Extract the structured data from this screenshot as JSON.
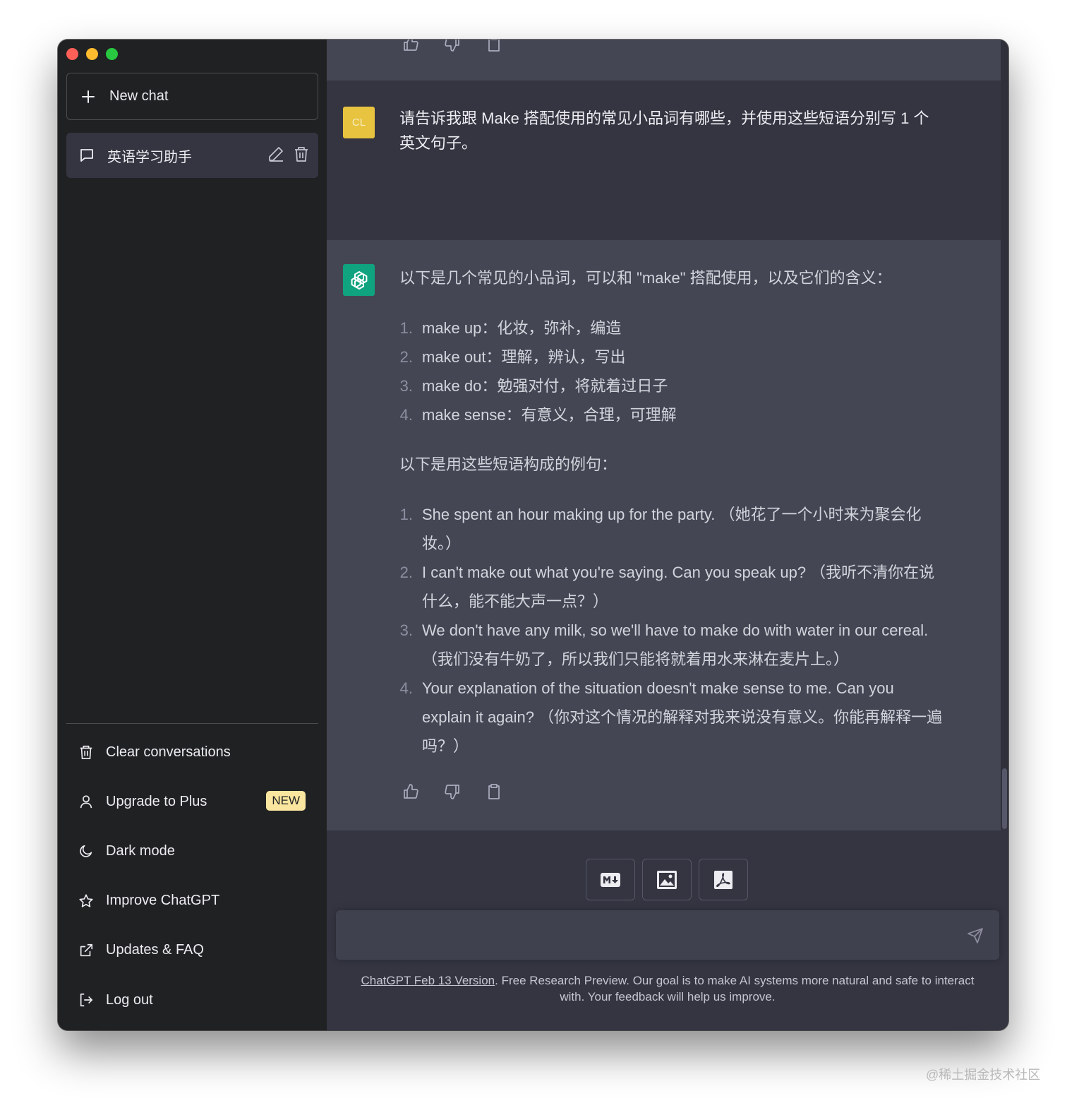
{
  "sidebar": {
    "new_chat_label": "New chat",
    "conversations": [
      {
        "title": "英语学习助手"
      }
    ],
    "menu": {
      "clear": "Clear conversations",
      "upgrade": "Upgrade to Plus",
      "upgrade_badge": "NEW",
      "dark_mode": "Dark mode",
      "improve": "Improve ChatGPT",
      "updates": "Updates & FAQ",
      "logout": "Log out"
    }
  },
  "chat": {
    "user_avatar": "CL",
    "user_message_line1": "请告诉我跟 Make 搭配使用的常见小品词有哪些，并使用这些短语分别写 1 个",
    "user_message_line2": "英文句子。",
    "assistant": {
      "intro": "以下是几个常见的小品词，可以和 \"make\" 搭配使用，以及它们的含义：",
      "phrases": [
        {
          "num": "1.",
          "text": "make up：化妆，弥补，编造"
        },
        {
          "num": "2.",
          "text": "make out：理解，辨认，写出"
        },
        {
          "num": "3.",
          "text": "make do：勉强对付，将就着过日子"
        },
        {
          "num": "4.",
          "text": "make sense：有意义，合理，可理解"
        }
      ],
      "examples_intro": "以下是用这些短语构成的例句：",
      "examples": [
        {
          "num": "1.",
          "line1": "She spent an hour making up for the party. （她花了一个小时来为聚会化",
          "line2": "妆。）"
        },
        {
          "num": "2.",
          "line1": "I can't make out what you're saying. Can you speak up? （我听不清你在说",
          "line2": "什么，能不能大声一点？）"
        },
        {
          "num": "3.",
          "line1": "We don't have any milk, so we'll have to make do with water in our cereal.",
          "line2": "（我们没有牛奶了，所以我们只能将就着用水来淋在麦片上。）"
        },
        {
          "num": "4.",
          "line1": "Your explanation of the situation doesn't make sense to me. Can you",
          "line2": "explain it again? （你对这个情况的解释对我来说没有意义。你能再解释一遍",
          "line3": "吗？）"
        }
      ]
    }
  },
  "input": {
    "placeholder": ""
  },
  "footer": {
    "link_text": "ChatGPT Feb 13 Version",
    "text": ". Free Research Preview. Our goal is to make AI systems more natural and safe to interact with. Your feedback will help us improve."
  },
  "watermark": "@稀土掘金技术社区",
  "colors": {
    "sidebar_bg": "#202123",
    "main_bg": "#343541",
    "assistant_bg": "#444654",
    "accent": "#10a37f",
    "user_avatar": "#e8c33f",
    "badge": "#fae69e"
  },
  "icons": [
    "plus-icon",
    "chat-bubble-icon",
    "pencil-icon",
    "trash-icon",
    "user-icon",
    "moon-icon",
    "star-icon",
    "external-link-icon",
    "logout-icon",
    "thumbs-up-icon",
    "thumbs-down-icon",
    "clipboard-icon",
    "markdown-icon",
    "image-icon",
    "pdf-icon",
    "send-icon",
    "openai-logo-icon"
  ]
}
